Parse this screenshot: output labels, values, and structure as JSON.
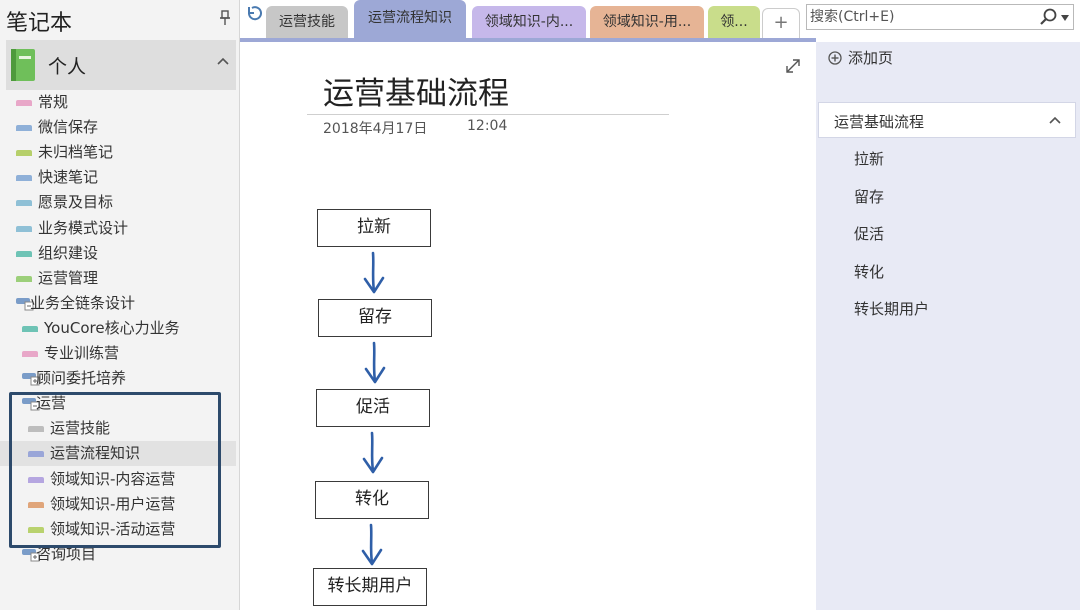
{
  "notebook": {
    "title": "笔记本",
    "current": "个人"
  },
  "sections": [
    {
      "label": "常规",
      "color": "#e8a7c8",
      "kind": "section"
    },
    {
      "label": "微信保存",
      "color": "#8fb0d8",
      "kind": "section"
    },
    {
      "label": "未归档笔记",
      "color": "#b6cf6a",
      "kind": "section"
    },
    {
      "label": "快速笔记",
      "color": "#8fb0d8",
      "kind": "section"
    },
    {
      "label": "愿景及目标",
      "color": "#8fc0d6",
      "kind": "section"
    },
    {
      "label": "业务模式设计",
      "color": "#8fc0d6",
      "kind": "section"
    },
    {
      "label": "组织建设",
      "color": "#6ec3b5",
      "kind": "section"
    },
    {
      "label": "运营管理",
      "color": "#9ccf7a",
      "kind": "section"
    },
    {
      "label": "业务全链条设计",
      "color": "#7a9cc8",
      "kind": "group"
    },
    {
      "label": "YouCore核心力业务",
      "color": "#6ec3b5",
      "kind": "section"
    },
    {
      "label": "专业训练营",
      "color": "#e8a7c8",
      "kind": "section"
    },
    {
      "label": "顾问委托培养",
      "color": "#7a9cc8",
      "kind": "group"
    },
    {
      "label": "运营",
      "color": "#7a9cc8",
      "kind": "group"
    },
    {
      "label": "运营技能",
      "color": "#bdbdbd",
      "kind": "section"
    },
    {
      "label": "运营流程知识",
      "color": "#9aa6d8",
      "kind": "section"
    },
    {
      "label": "领域知识-内容运营",
      "color": "#b5a6e0",
      "kind": "section"
    },
    {
      "label": "领域知识-用户运营",
      "color": "#e0a57a",
      "kind": "section"
    },
    {
      "label": "领域知识-活动运营",
      "color": "#b9d26e",
      "kind": "section"
    },
    {
      "label": "咨询项目",
      "color": "#7a9cc8",
      "kind": "group"
    }
  ],
  "section_tabs": [
    {
      "label": "运营技能",
      "color": "#c7c7c7"
    },
    {
      "label": "运营流程知识",
      "color": "#9da8d6"
    },
    {
      "label": "领域知识-内...",
      "color": "#c6b8ea"
    },
    {
      "label": "领域知识-用...",
      "color": "#e6b495"
    },
    {
      "label": "领...",
      "color": "#c9dd8b"
    }
  ],
  "add_tab_label": "+",
  "search": {
    "placeholder": "搜索(Ctrl+E)"
  },
  "page": {
    "title": "运营基础流程",
    "date": "2018年4月17日",
    "time": "12:04",
    "flow": [
      "拉新",
      "留存",
      "促活",
      "转化",
      "转长期用户"
    ]
  },
  "pages_panel": {
    "add_page": "添加页",
    "main_page": "运营基础流程",
    "subpages": [
      "拉新",
      "留存",
      "促活",
      "转化",
      "转长期用户"
    ]
  }
}
